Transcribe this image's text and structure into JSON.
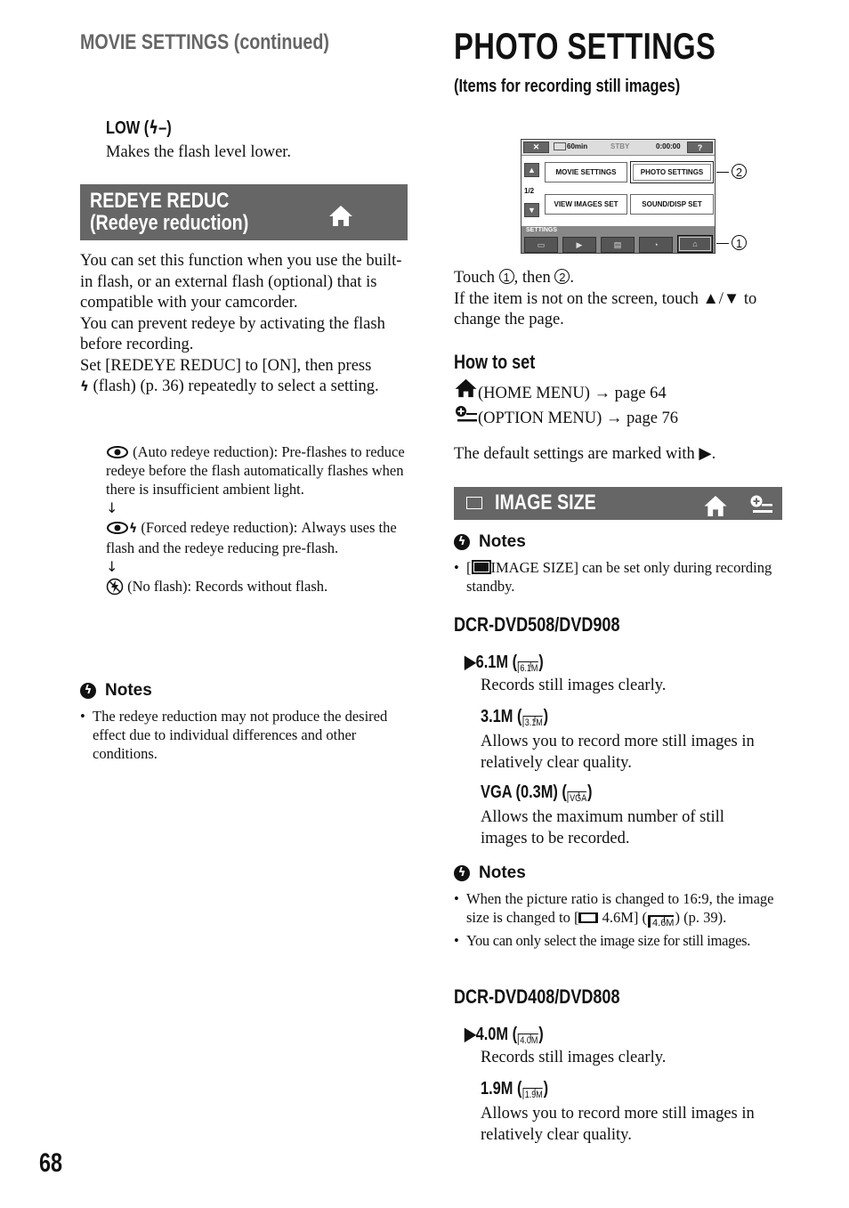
{
  "page_number": "68",
  "left": {
    "running_header": "MOVIE SETTINGS (continued)",
    "low_item": {
      "title": "LOW (⚡–)",
      "title_text": "LOW (",
      "title_flash": "ϟ",
      "title_end": "–)",
      "desc": "Makes the flash level lower."
    },
    "redeye_bar": {
      "line1": "REDEYE REDUC",
      "line2": "(Redeye reduction)",
      "icon": "home-icon"
    },
    "intro": [
      "You can set this function when you use the built-in flash, or an external flash (optional) that is compatible with your camcorder.",
      "You can prevent redeye by activating the flash before recording.",
      "Set [REDEYE REDUC] to [ON], then press",
      "(flash) (p. 36) repeatedly to select a setting."
    ],
    "modes": [
      {
        "icon": "redeye-icon",
        "text": "(Auto redeye reduction): Pre-flashes to reduce redeye before the flash automatically flashes when there is insufficient ambient light."
      },
      {
        "icon": "redeye-flash-icon",
        "text": "(Forced redeye reduction): Always uses the flash and the redeye reducing pre-flash."
      },
      {
        "icon": "no-flash-icon",
        "text": "(No flash): Records without flash."
      }
    ],
    "arrow": "↓",
    "notes_title": "Notes",
    "notes": [
      "The redeye reduction may not produce the desired effect due to individual differences and other conditions."
    ]
  },
  "right": {
    "title": "PHOTO SETTINGS",
    "subtitle": "(Items for recording still images)",
    "lcd": {
      "close": "✕",
      "battery": "60min",
      "status": "STBY",
      "time": "0:00:00",
      "help": "?",
      "page": "1/2",
      "buttons": [
        "MOVIE SETTINGS",
        "PHOTO SETTINGS",
        "VIEW IMAGES SET",
        "SOUND/DISP SET"
      ],
      "strip_label": "SETTINGS",
      "callout_1": "1",
      "callout_2": "2"
    },
    "touch_line_a": "Touch ",
    "touch_c1": "1",
    "touch_line_b": ", then ",
    "touch_c2": "2",
    "touch_line_c": ".",
    "touch_line2": "If the item is not on the screen, touch ▲/▼ to change the page.",
    "how_to_set": "How to set",
    "home_menu": "(HOME MENU) → page 64",
    "option_menu": "(OPTION MENU) → page 76",
    "default_note": "The default settings are marked with ▶.",
    "image_size_bar": "IMAGE SIZE",
    "notes1_title": "Notes",
    "notes1": [
      {
        "pre": "[",
        "post": "IMAGE SIZE] can be set only during recording standby."
      }
    ],
    "model1": "DCR-DVD508/DVD908",
    "model1_items": [
      {
        "marker": "▶",
        "label": "6.1M (",
        "icon": "6.1M",
        "end": ")",
        "desc": "Records still images clearly."
      },
      {
        "marker": "",
        "label": "3.1M (",
        "icon": "3.1M",
        "end": ")",
        "desc": "Allows you to record more still images in relatively clear quality."
      },
      {
        "marker": "",
        "label": "VGA (0.3M) (",
        "icon": "VGA",
        "end": ")",
        "desc": "Allows the maximum number of still images to be recorded."
      }
    ],
    "notes2_title": "Notes",
    "notes2": [
      {
        "a": "When the picture ratio is changed to 16:9, the image size is changed to [",
        "b": " 4.6M] (",
        "icon": "4.6M",
        "c": ") (p. 39)."
      },
      {
        "a": "You can only select the image size for still images."
      }
    ],
    "model2": "DCR-DVD408/DVD808",
    "model2_items": [
      {
        "marker": "▶",
        "label": "4.0M (",
        "icon": "4.0M",
        "end": ")",
        "desc": "Records still images clearly."
      },
      {
        "marker": "",
        "label": "1.9M (",
        "icon": "1.9M",
        "end": ")",
        "desc": "Allows you to record more still images in relatively clear quality."
      }
    ]
  }
}
